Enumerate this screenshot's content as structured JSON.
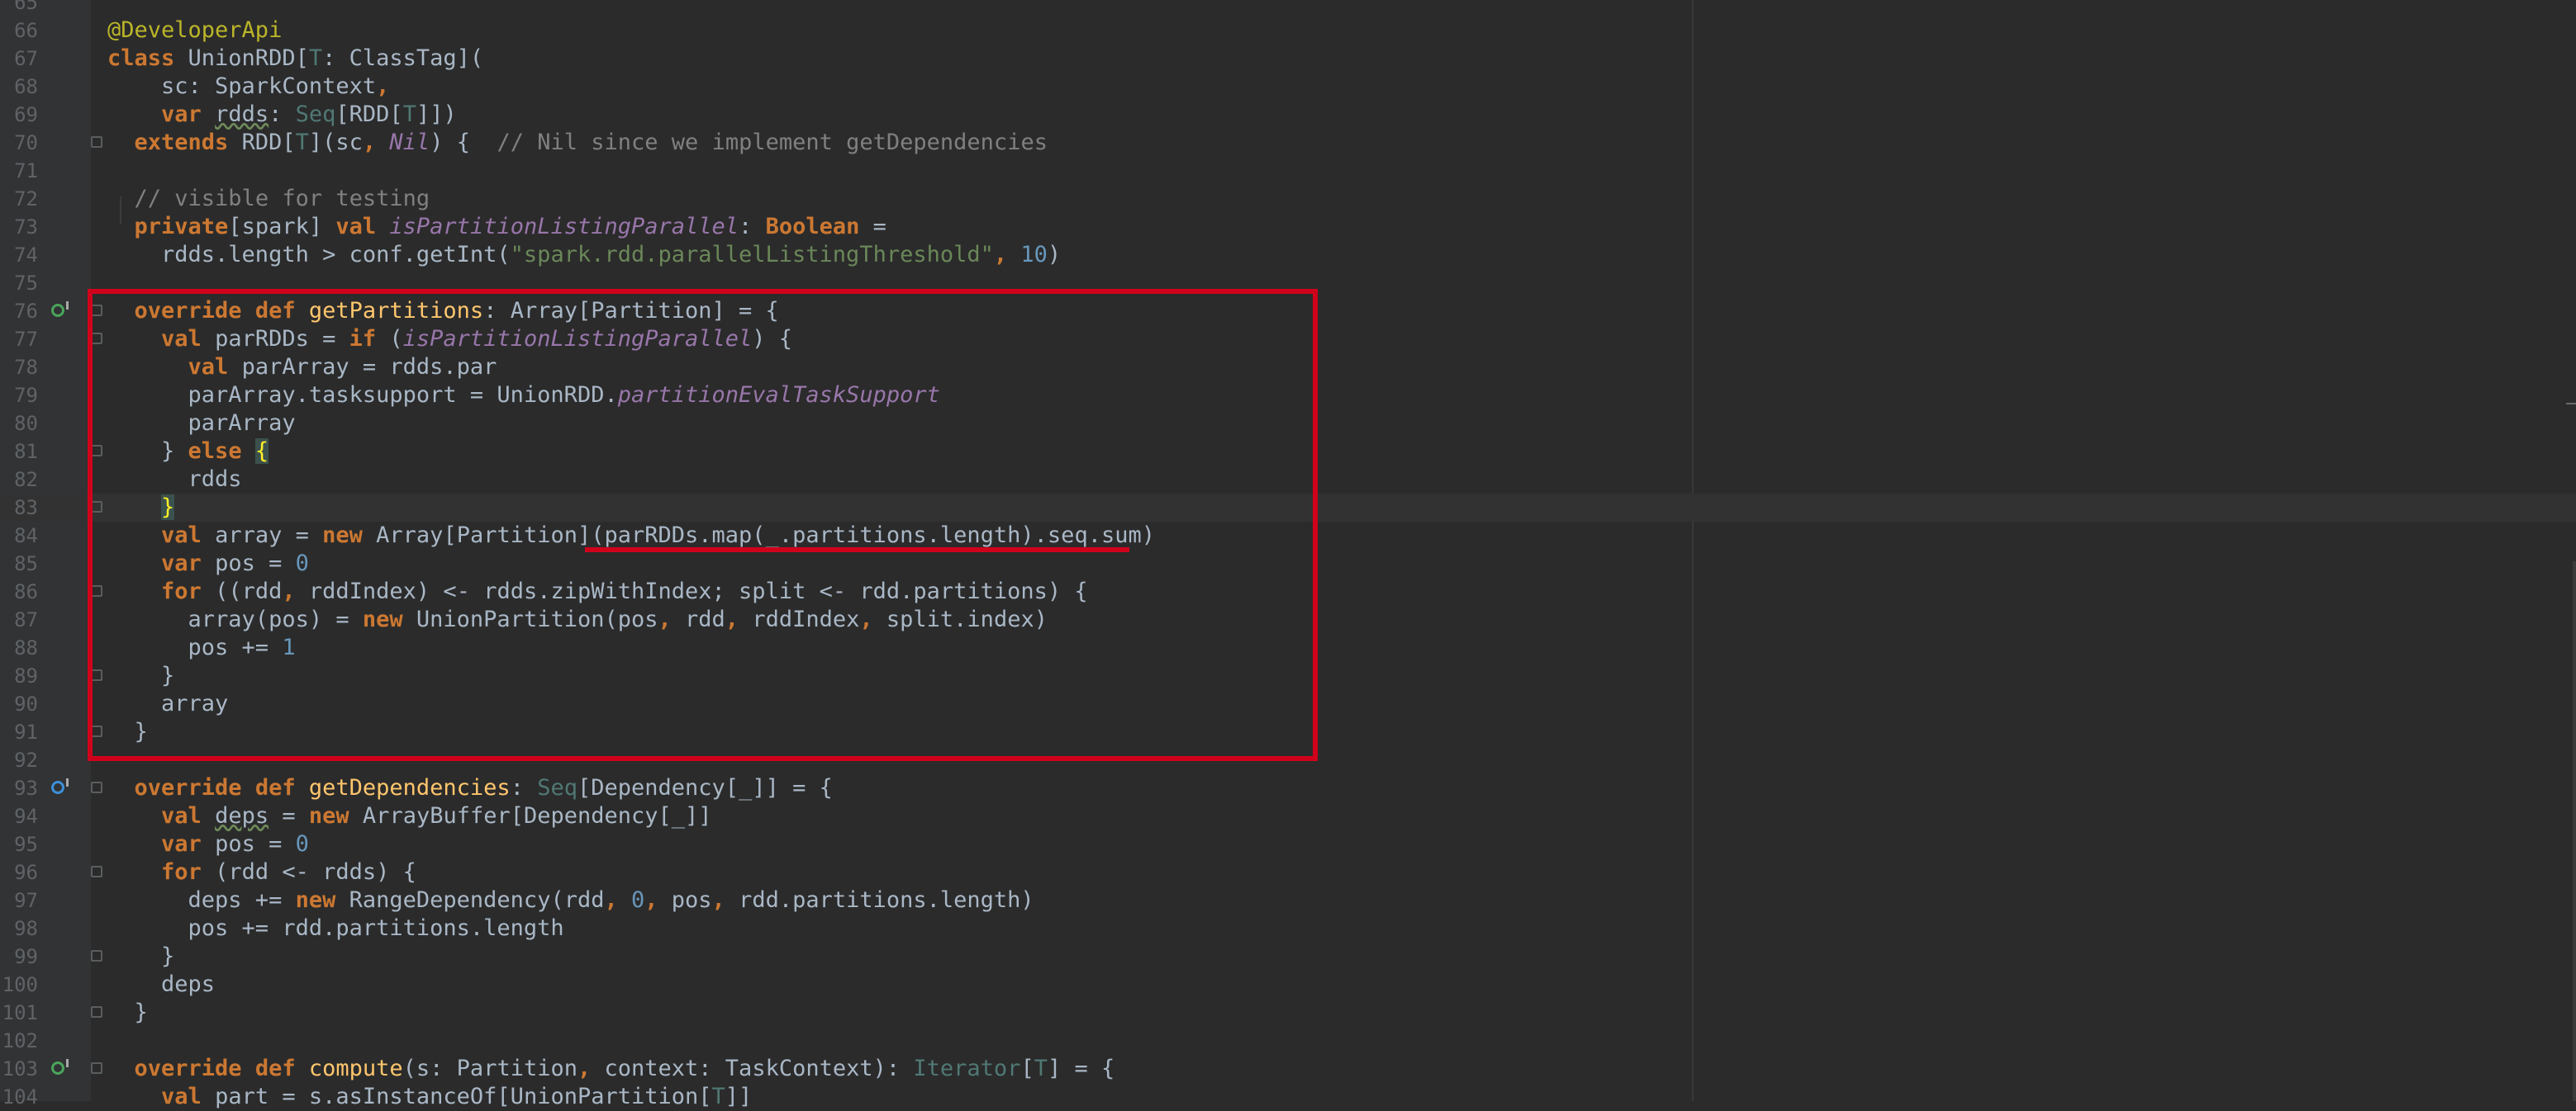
{
  "editor": {
    "lines": [
      {
        "num": "65",
        "segs": []
      },
      {
        "num": "66",
        "segs": [
          {
            "t": "@DeveloperApi",
            "c": "an"
          }
        ]
      },
      {
        "num": "67",
        "segs": [
          {
            "t": "class",
            "c": "kw"
          },
          {
            "t": " UnionRDD["
          },
          {
            "t": "T",
            "c": "tp"
          },
          {
            "t": ": ClassTag]("
          }
        ]
      },
      {
        "num": "68",
        "segs": [
          {
            "t": "    sc: SparkContext"
          },
          {
            "t": ",",
            "c": "kw"
          }
        ]
      },
      {
        "num": "69",
        "segs": [
          {
            "t": "    "
          },
          {
            "t": "var",
            "c": "kw"
          },
          {
            "t": " "
          },
          {
            "t": "rdds",
            "c": "ul"
          },
          {
            "t": ": "
          },
          {
            "t": "Seq",
            "c": "tp"
          },
          {
            "t": "[RDD["
          },
          {
            "t": "T",
            "c": "tp"
          },
          {
            "t": "]])"
          }
        ]
      },
      {
        "num": "70",
        "segs": [
          {
            "t": "  "
          },
          {
            "t": "extends",
            "c": "kw"
          },
          {
            "t": " RDD["
          },
          {
            "t": "T",
            "c": "tp"
          },
          {
            "t": "](sc"
          },
          {
            "t": ",",
            "c": "kw"
          },
          {
            "t": " "
          },
          {
            "t": "Nil",
            "c": "it"
          },
          {
            "t": ") {  "
          },
          {
            "t": "// Nil since we implement getDependencies",
            "c": "cm"
          }
        ]
      },
      {
        "num": "71",
        "segs": []
      },
      {
        "num": "72",
        "segs": [
          {
            "t": "  "
          },
          {
            "t": "// visible for testing",
            "c": "cm"
          }
        ]
      },
      {
        "num": "73",
        "segs": [
          {
            "t": "  "
          },
          {
            "t": "private",
            "c": "kw"
          },
          {
            "t": "[spark] "
          },
          {
            "t": "val",
            "c": "kw"
          },
          {
            "t": " "
          },
          {
            "t": "isPartitionListingParallel",
            "c": "it"
          },
          {
            "t": ": "
          },
          {
            "t": "Boolean",
            "c": "kw"
          },
          {
            "t": " ="
          }
        ]
      },
      {
        "num": "74",
        "segs": [
          {
            "t": "    rdds.length > conf.getInt("
          },
          {
            "t": "\"spark.rdd.parallelListingThreshold\"",
            "c": "st"
          },
          {
            "t": ", ",
            "c": "kw"
          },
          {
            "t": "10",
            "c": "nm"
          },
          {
            "t": ")"
          }
        ]
      },
      {
        "num": "75",
        "segs": []
      },
      {
        "num": "76",
        "mark": "o",
        "segs": [
          {
            "t": "  "
          },
          {
            "t": "override def",
            "c": "kw"
          },
          {
            "t": " "
          },
          {
            "t": "getPartitions",
            "c": "fn"
          },
          {
            "t": ": Array[Partition] = {"
          }
        ]
      },
      {
        "num": "77",
        "segs": [
          {
            "t": "    "
          },
          {
            "t": "val",
            "c": "kw"
          },
          {
            "t": " parRDDs = "
          },
          {
            "t": "if",
            "c": "kw"
          },
          {
            "t": " ("
          },
          {
            "t": "isPartitionListingParallel",
            "c": "it"
          },
          {
            "t": ") {"
          }
        ]
      },
      {
        "num": "78",
        "segs": [
          {
            "t": "      "
          },
          {
            "t": "val",
            "c": "kw"
          },
          {
            "t": " parArray = rdds.par"
          }
        ]
      },
      {
        "num": "79",
        "segs": [
          {
            "t": "      parArray.tasksupport = UnionRDD."
          },
          {
            "t": "partitionEvalTaskSupport",
            "c": "it"
          }
        ]
      },
      {
        "num": "80",
        "segs": [
          {
            "t": "      parArray"
          }
        ]
      },
      {
        "num": "81",
        "segs": [
          {
            "t": "    } "
          },
          {
            "t": "else",
            "c": "kw"
          },
          {
            "t": " "
          },
          {
            "t": "{",
            "c": "hb"
          }
        ]
      },
      {
        "num": "82",
        "segs": [
          {
            "t": "      rdds"
          }
        ]
      },
      {
        "num": "83",
        "current": true,
        "segs": [
          {
            "t": "    "
          },
          {
            "t": "}",
            "c": "hb"
          }
        ]
      },
      {
        "num": "84",
        "segs": [
          {
            "t": "    "
          },
          {
            "t": "val",
            "c": "kw"
          },
          {
            "t": " array = "
          },
          {
            "t": "new",
            "c": "kw"
          },
          {
            "t": " Array[Partition](parRDDs.map(_.partitions.length).seq.sum)"
          }
        ]
      },
      {
        "num": "85",
        "segs": [
          {
            "t": "    "
          },
          {
            "t": "var",
            "c": "kw"
          },
          {
            "t": " pos = "
          },
          {
            "t": "0",
            "c": "nm"
          }
        ]
      },
      {
        "num": "86",
        "segs": [
          {
            "t": "    "
          },
          {
            "t": "for",
            "c": "kw"
          },
          {
            "t": " ((rdd"
          },
          {
            "t": ",",
            "c": "kw"
          },
          {
            "t": " rddIndex) <- rdds.zipWithIndex; split <- rdd.partitions) {"
          }
        ]
      },
      {
        "num": "87",
        "segs": [
          {
            "t": "      array(pos) = "
          },
          {
            "t": "new",
            "c": "kw"
          },
          {
            "t": " UnionPartition(pos"
          },
          {
            "t": ",",
            "c": "kw"
          },
          {
            "t": " rdd"
          },
          {
            "t": ",",
            "c": "kw"
          },
          {
            "t": " rddIndex"
          },
          {
            "t": ",",
            "c": "kw"
          },
          {
            "t": " split.index)"
          }
        ]
      },
      {
        "num": "88",
        "segs": [
          {
            "t": "      pos += "
          },
          {
            "t": "1",
            "c": "nm"
          }
        ]
      },
      {
        "num": "89",
        "segs": [
          {
            "t": "    }"
          }
        ]
      },
      {
        "num": "90",
        "segs": [
          {
            "t": "    array"
          }
        ]
      },
      {
        "num": "91",
        "segs": [
          {
            "t": "  }"
          }
        ]
      },
      {
        "num": "92",
        "segs": []
      },
      {
        "num": "93",
        "mark": "i",
        "segs": [
          {
            "t": "  "
          },
          {
            "t": "override def",
            "c": "kw"
          },
          {
            "t": " "
          },
          {
            "t": "getDependencies",
            "c": "fn"
          },
          {
            "t": ": "
          },
          {
            "t": "Seq",
            "c": "tp"
          },
          {
            "t": "[Dependency[_]] = {"
          }
        ]
      },
      {
        "num": "94",
        "segs": [
          {
            "t": "    "
          },
          {
            "t": "val",
            "c": "kw"
          },
          {
            "t": " "
          },
          {
            "t": "deps",
            "c": "ul"
          },
          {
            "t": " = "
          },
          {
            "t": "new",
            "c": "kw"
          },
          {
            "t": " ArrayBuffer[Dependency[_]]"
          }
        ]
      },
      {
        "num": "95",
        "segs": [
          {
            "t": "    "
          },
          {
            "t": "var",
            "c": "kw"
          },
          {
            "t": " pos = "
          },
          {
            "t": "0",
            "c": "nm"
          }
        ]
      },
      {
        "num": "96",
        "segs": [
          {
            "t": "    "
          },
          {
            "t": "for",
            "c": "kw"
          },
          {
            "t": " (rdd <- rdds) {"
          }
        ]
      },
      {
        "num": "97",
        "segs": [
          {
            "t": "      deps += "
          },
          {
            "t": "new",
            "c": "kw"
          },
          {
            "t": " RangeDependency(rdd"
          },
          {
            "t": ", ",
            "c": "kw"
          },
          {
            "t": "0",
            "c": "nm"
          },
          {
            "t": ", ",
            "c": "kw"
          },
          {
            "t": "pos"
          },
          {
            "t": ", ",
            "c": "kw"
          },
          {
            "t": "rdd.partitions.length)"
          }
        ]
      },
      {
        "num": "98",
        "segs": [
          {
            "t": "      pos += rdd.partitions.length"
          }
        ]
      },
      {
        "num": "99",
        "segs": [
          {
            "t": "    }"
          }
        ]
      },
      {
        "num": "100",
        "segs": [
          {
            "t": "    deps"
          }
        ]
      },
      {
        "num": "101",
        "segs": [
          {
            "t": "  }"
          }
        ]
      },
      {
        "num": "102",
        "segs": []
      },
      {
        "num": "103",
        "mark": "o",
        "segs": [
          {
            "t": "  "
          },
          {
            "t": "override def",
            "c": "kw"
          },
          {
            "t": " "
          },
          {
            "t": "compute",
            "c": "fn"
          },
          {
            "t": "(s: Partition"
          },
          {
            "t": ",",
            "c": "kw"
          },
          {
            "t": " context: TaskContext): "
          },
          {
            "t": "Iterator",
            "c": "tp"
          },
          {
            "t": "["
          },
          {
            "t": "T",
            "c": "tp"
          },
          {
            "t": "] = {"
          }
        ]
      },
      {
        "num": "104",
        "segs": [
          {
            "t": "    "
          },
          {
            "t": "val",
            "c": "kw"
          },
          {
            "t": " part = s.asInstanceOf[UnionPartition["
          },
          {
            "t": "T",
            "c": "tp"
          },
          {
            "t": "]]"
          }
        ]
      }
    ]
  },
  "colors": {
    "background": "#2b2b2b",
    "keyword": "#cc7832",
    "annotation": "#bbb529",
    "function": "#ffc66d",
    "type": "#507874",
    "italic_field": "#9876aa",
    "comment": "#808080",
    "string": "#6a8759",
    "number": "#6897bb",
    "highlight_box": "#d0021b"
  },
  "icons": {
    "override_marker": "override-method-icon",
    "implement_marker": "implement-method-icon",
    "fold_marker": "fold-toggle-icon"
  }
}
